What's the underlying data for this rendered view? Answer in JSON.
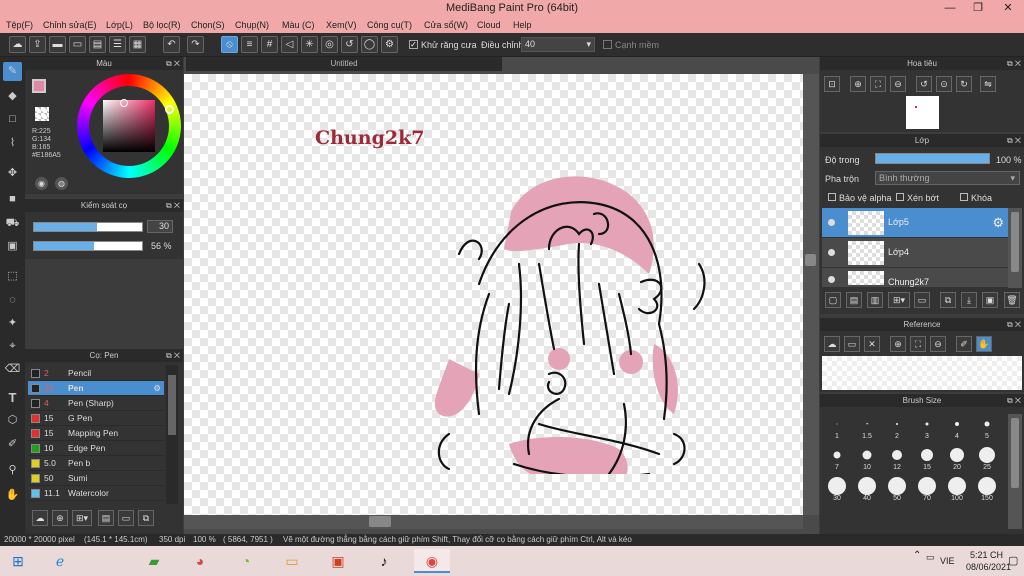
{
  "window": {
    "title": "MediBang Paint Pro (64bit)",
    "minimize": "—",
    "maximize": "❐",
    "close": "✕"
  },
  "menu": [
    "Tệp(F)",
    "Chỉnh sửa(E)",
    "Lớp(L)",
    "Bộ lọc(R)",
    "Chọn(S)",
    "Chụp(N)",
    "Màu (C)",
    "Xem(V)",
    "Công cụ(T)",
    "Cửa sổ(W)",
    "Cloud",
    "Help"
  ],
  "toolbar": {
    "antialias_label": "Khử răng cưa",
    "correction_label": "Điều chỉnh",
    "correction_value": "40",
    "sharp_edge_label": "Cạnh mềm"
  },
  "color_panel": {
    "title": "Màu",
    "r": "R:225",
    "g": "G:134",
    "b": "B:165",
    "hex": "#E186A5"
  },
  "brush_control": {
    "title": "Kiểm soát cọ",
    "size_value": "30",
    "opacity_value": "56 %",
    "size_fraction": 0.58,
    "opacity_fraction": 0.56
  },
  "brush_panel": {
    "title": "Cọ: Pen",
    "items": [
      {
        "size": "2",
        "name": "Pencil",
        "color": "#222222",
        "size_color": "#e06060"
      },
      {
        "size": "30",
        "name": "Pen",
        "color": "#222222",
        "size_color": "#e06060",
        "selected": true
      },
      {
        "size": "4",
        "name": "Pen (Sharp)",
        "color": "#222222",
        "size_color": "#e06060"
      },
      {
        "size": "15",
        "name": "G Pen",
        "color": "#e03030",
        "size_color": "#dddddd"
      },
      {
        "size": "15",
        "name": "Mapping Pen",
        "color": "#e03030",
        "size_color": "#dddddd"
      },
      {
        "size": "10",
        "name": "Edge Pen",
        "color": "#20a020",
        "size_color": "#dddddd"
      },
      {
        "size": "5.0",
        "name": "Pen b",
        "color": "#e0d020",
        "size_color": "#dddddd"
      },
      {
        "size": "50",
        "name": "Sumi",
        "color": "#e0d020",
        "size_color": "#dddddd"
      },
      {
        "size": "11.1",
        "name": "Watercolor",
        "color": "#60c0f0",
        "size_color": "#dddddd"
      }
    ]
  },
  "canvas": {
    "tab": "Untitled",
    "signature": "Chung2k7"
  },
  "navigator": {
    "title": "Hoa tiêu"
  },
  "layers": {
    "title": "Lớp",
    "opacity_label": "Độ trong",
    "opacity_value": "100 %",
    "opacity_fraction": 1.0,
    "blend_label": "Pha trộn",
    "blend_value": "Bình thường",
    "protect_alpha": "Bảo vệ alpha",
    "clipping": "Xén bớt",
    "lock": "Khóa",
    "items": [
      {
        "name": "Lớp5",
        "selected": true
      },
      {
        "name": "Lớp4"
      },
      {
        "name": "Chung2k7"
      }
    ]
  },
  "reference": {
    "title": "Reference"
  },
  "brush_size": {
    "title": "Brush Size",
    "sizes": [
      "1",
      "1.5",
      "2",
      "3",
      "4",
      "5",
      "7",
      "10",
      "12",
      "15",
      "20",
      "25",
      "30",
      "40",
      "50",
      "70",
      "100",
      "150"
    ]
  },
  "status": {
    "dimensions": "20000 * 20000 pixel",
    "physical": "(145.1 * 145.1cm)",
    "dpi": "350 dpi",
    "zoom": "100 %",
    "coords": "( 5864, 7951 )",
    "hint": "Vẽ một đường thẳng bằng cách giữ phím Shift, Thay đổi cỡ cọ bằng cách giữ phím Ctrl, Alt và kéo"
  },
  "taskbar": {
    "lang": "VIE",
    "time": "5:21 CH",
    "date": "08/06/2021"
  }
}
